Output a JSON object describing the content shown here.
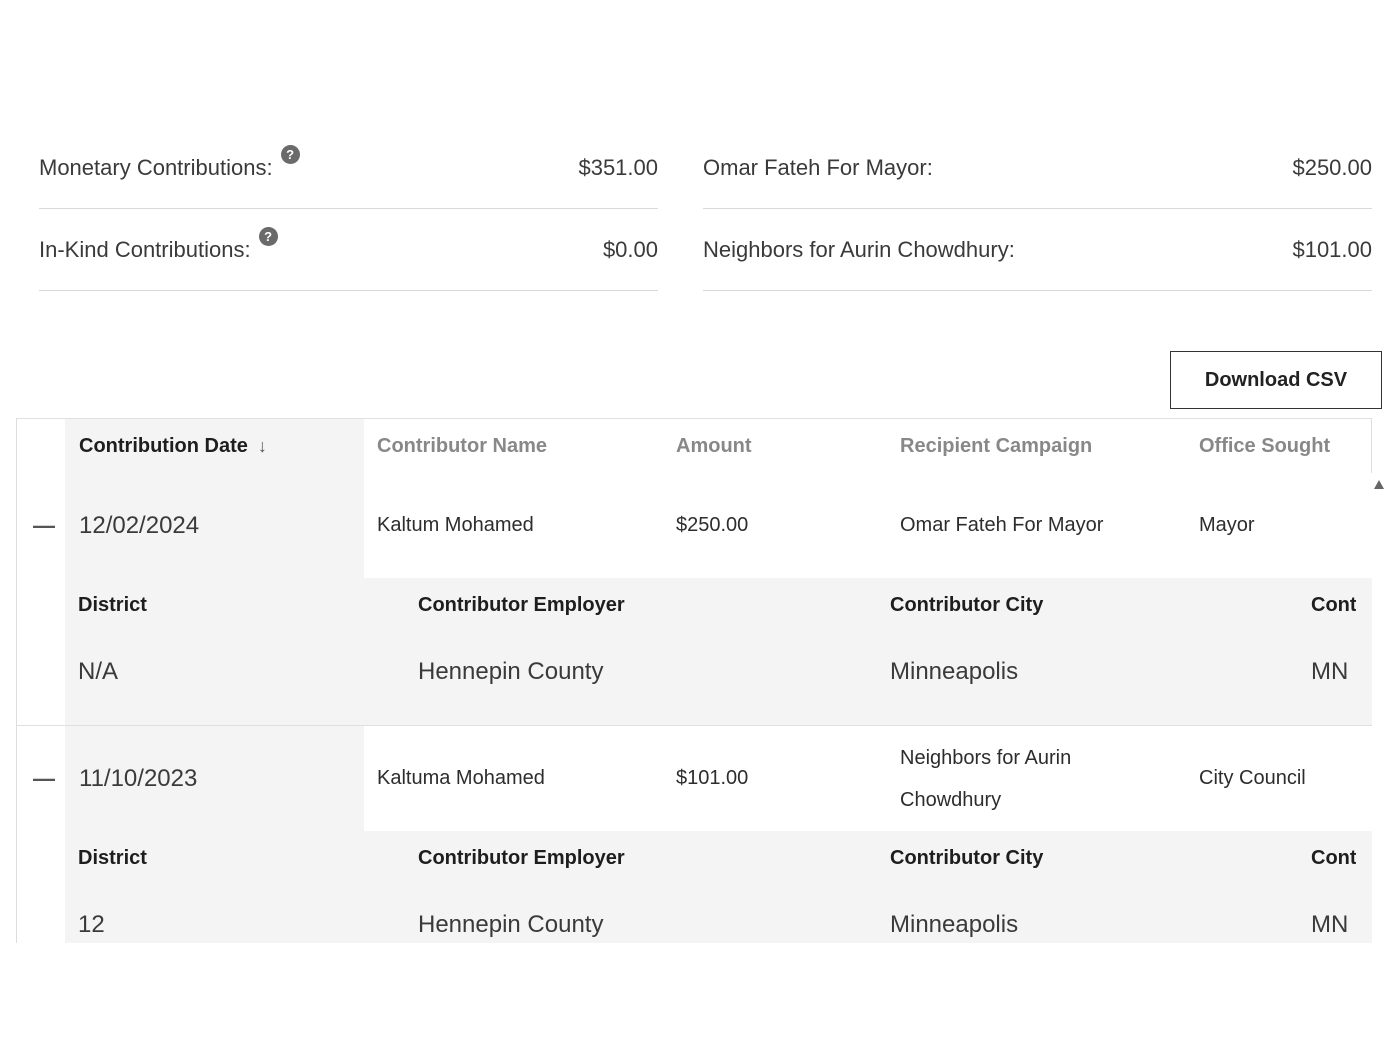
{
  "summary": {
    "left": [
      {
        "label": "Monetary Contributions:",
        "value": "$351.00",
        "help": "?"
      },
      {
        "label": "In-Kind Contributions:",
        "value": "$0.00",
        "help": "?"
      }
    ],
    "right": [
      {
        "label": "Omar Fateh For Mayor:",
        "value": "$250.00"
      },
      {
        "label": "Neighbors for Aurin Chowdhury:",
        "value": "$101.00"
      }
    ]
  },
  "download_label": "Download CSV",
  "table": {
    "headers": {
      "date": "Contribution Date",
      "sort_arrow": "↓",
      "name": "Contributor Name",
      "amount": "Amount",
      "campaign": "Recipient Campaign",
      "office": "Office Sought"
    },
    "detail_headers": {
      "district": "District",
      "employer": "Contributor Employer",
      "city": "Contributor City",
      "state": "Contril"
    },
    "rows": [
      {
        "toggle": "—",
        "date": "12/02/2024",
        "name": "Kaltum Mohamed",
        "amount": "$250.00",
        "campaign_line1": "Omar Fateh For Mayor",
        "campaign_line2": "",
        "office": "Mayor",
        "district": "N/A",
        "employer": "Hennepin County",
        "city": "Minneapolis",
        "state": "MN"
      },
      {
        "toggle": "—",
        "date": "11/10/2023",
        "name": "Kaltuma Mohamed",
        "amount": "$101.00",
        "campaign_line1": "Neighbors for Aurin",
        "campaign_line2": "Chowdhury",
        "office": "City Council",
        "district": "12",
        "employer": "Hennepin County",
        "city": "Minneapolis",
        "state": "MN"
      }
    ]
  }
}
